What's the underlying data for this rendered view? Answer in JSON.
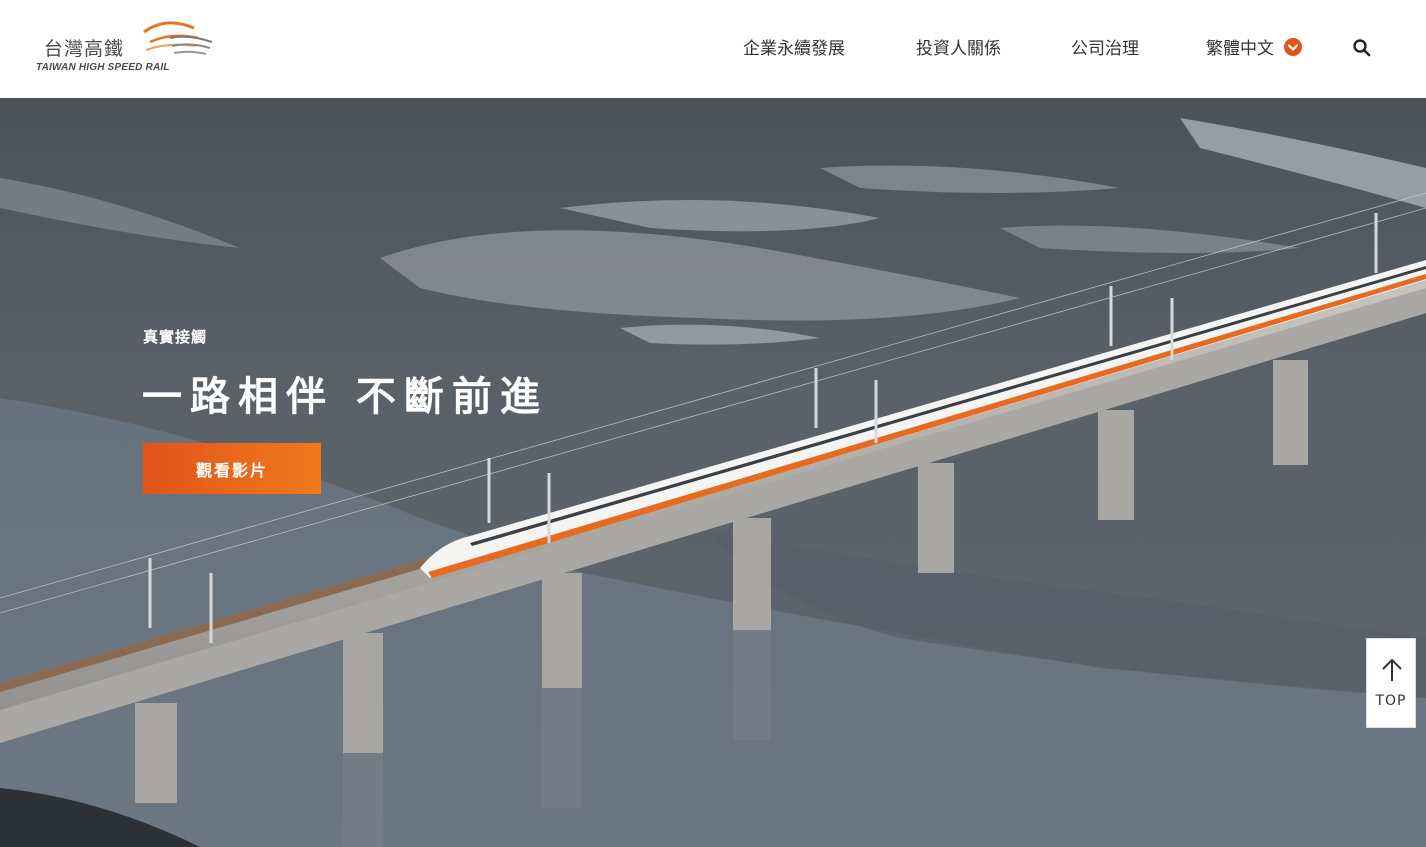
{
  "brand": {
    "name_zh": "台灣高鐵",
    "name_en": "TAIWAN HIGH SPEED RAIL"
  },
  "nav": {
    "items": [
      {
        "label": "企業永續發展"
      },
      {
        "label": "投資人關係"
      },
      {
        "label": "公司治理"
      }
    ],
    "language": "繁體中文",
    "search_icon": "search-icon"
  },
  "hero": {
    "subtitle": "真實接觸",
    "title": "一路相伴 不斷前進",
    "button_label": "觀看影片"
  },
  "back_to_top": {
    "label": "TOP",
    "icon": "arrow-up-icon"
  },
  "colors": {
    "accent": "#e2541a",
    "accent_light": "#f07a1c",
    "logo_orange": "#e8731f"
  }
}
